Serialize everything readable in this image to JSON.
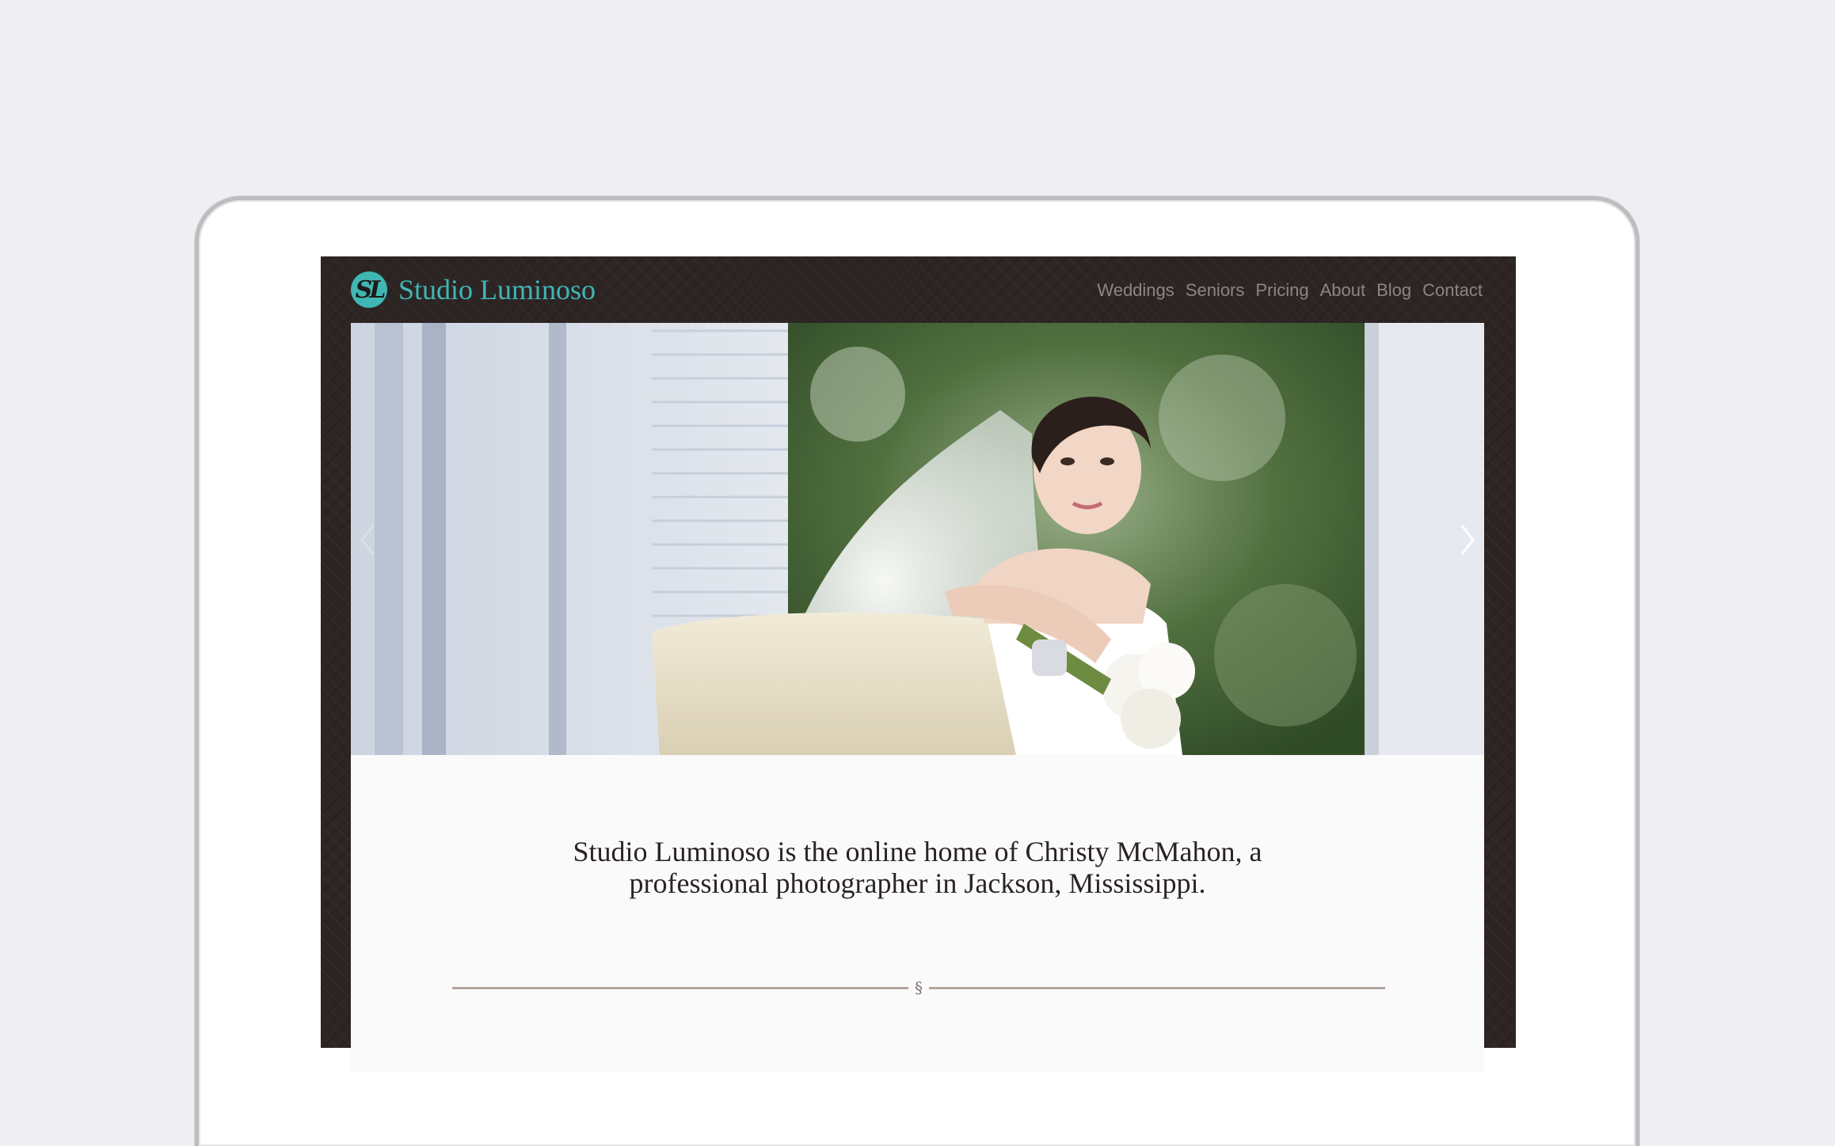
{
  "site": {
    "logo_initials": "SL",
    "name": "Studio Luminoso",
    "accent_color": "#3fb7b4",
    "background_color": "#2d2524"
  },
  "nav": {
    "items": [
      "Weddings",
      "Seniors",
      "Pricing",
      "About",
      "Blog",
      "Contact"
    ]
  },
  "slideshow": {
    "image_alt": "bride-portrait-photo",
    "prev_icon": "chevron-left-icon",
    "next_icon": "chevron-right-icon"
  },
  "intro": {
    "text": "Studio Luminoso is the online home of Christy McMahon, a professional photographer in Jackson, Mississippi."
  },
  "divider": {
    "mark": "§"
  }
}
